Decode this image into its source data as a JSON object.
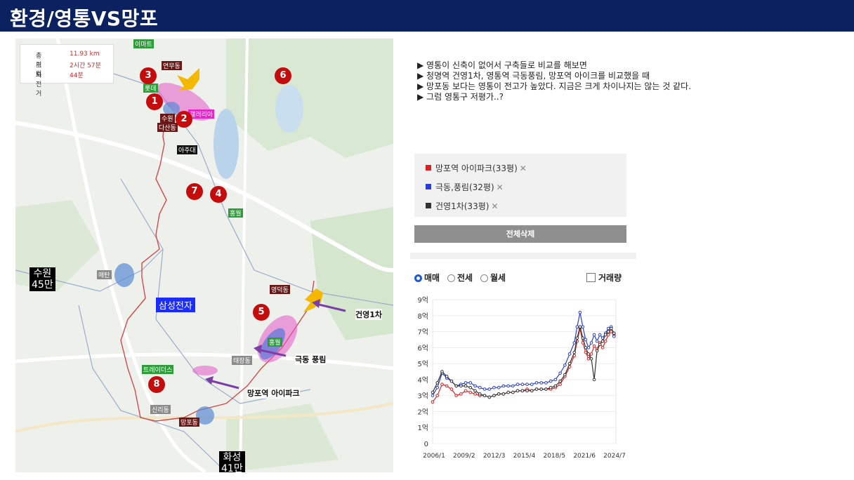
{
  "header": {
    "title": "환경/영통VS망포"
  },
  "map": {
    "route_info": [
      {
        "label": "총거리",
        "value": "11.93 km"
      },
      {
        "label": "도보",
        "value": "2시간 57분"
      },
      {
        "label": "자전거",
        "value": "44분"
      }
    ],
    "place_labels": {
      "emart": "이마트",
      "lotte": "롯데",
      "yeonmu": "연무동",
      "suwon": "수원",
      "dasandong": "다산동",
      "galleria": "갤러리아",
      "ajou": "아주대",
      "hongjin": "홍월",
      "hwangbong": "매탄",
      "samsung": "삼성전자",
      "yeongdeok": "영덕동",
      "yeongtong_green": "홍월",
      "taejang": "태장동",
      "traders": "트레이더스",
      "mangpo": "망포동",
      "sinsu": "신리동"
    },
    "cities": [
      {
        "line1": "수원",
        "line2": "45만"
      },
      {
        "line1": "화성",
        "line2": "41만"
      }
    ],
    "markers": [
      "1",
      "2",
      "3",
      "4",
      "5",
      "6",
      "7",
      "8"
    ],
    "callouts": {
      "gunyoung": "건영1차",
      "geukdong": "극동 풍림",
      "mangpo_ipark": "망포역 아이파크"
    }
  },
  "notes": [
    "▶  영통이 신축이 없어서 구축들로 비교를 해보면",
    "▶  청명역 건영1차, 영통역 극동풍림, 망포역 아이크를 비교했을 때",
    "▶  망포동 보다는 영통이 전고가 높았다.  지금은 크게 차이나지는 않는 것 같다.",
    "▶  그럼 영통구 저평가..?"
  ],
  "legend": [
    {
      "name": "망포역 아이파크(33평)",
      "color": "#e02020",
      "remove": "✕"
    },
    {
      "name": "극동,풍림(32평)",
      "color": "#2b3fd8",
      "remove": "✕"
    },
    {
      "name": "건영1차(33평)",
      "color": "#333333",
      "remove": "✕"
    }
  ],
  "clear_all": "전체삭제",
  "trade_type": {
    "options": [
      "매매",
      "전세",
      "월세"
    ],
    "selected": "매매"
  },
  "volume_label": "거래량",
  "colors": {
    "header": "#0b2160",
    "accent_blue": "#1e5ad8"
  },
  "chart_data": {
    "type": "line",
    "yticks": [
      "9억",
      "8억",
      "7억",
      "6억",
      "5억",
      "4억",
      "3억",
      "2억",
      "1억",
      "0"
    ],
    "xticks": [
      "2006/1",
      "2009/2",
      "2012/3",
      "2015/4",
      "2018/5",
      "2021/6",
      "2024/7"
    ],
    "ylim": [
      0,
      9
    ],
    "xlim": [
      2006.0,
      2025.4
    ],
    "grid": true,
    "series": [
      {
        "name": "망포역 아이파크(33평)",
        "color": "#e02020",
        "x": [
          2006.0,
          2006.5,
          2007.0,
          2007.5,
          2008.0,
          2008.5,
          2009.0,
          2009.5,
          2010.0,
          2010.5,
          2011.0,
          2011.5,
          2012.0,
          2012.5,
          2013.0,
          2013.5,
          2014.0,
          2014.5,
          2015.0,
          2015.5,
          2016.0,
          2016.5,
          2017.0,
          2017.5,
          2018.0,
          2018.5,
          2019.0,
          2019.5,
          2020.0,
          2020.5,
          2021.0,
          2021.3,
          2021.6,
          2021.9,
          2022.2,
          2022.5,
          2022.8,
          2023.1,
          2023.4,
          2023.7,
          2024.0,
          2024.3,
          2024.6,
          2024.9,
          2025.2
        ],
        "values": [
          2.6,
          3.0,
          3.7,
          3.6,
          3.4,
          3.0,
          3.1,
          3.3,
          3.2,
          3.1,
          3.0,
          3.0,
          2.9,
          3.0,
          3.1,
          3.1,
          3.2,
          3.2,
          3.3,
          3.3,
          3.4,
          3.3,
          3.4,
          3.4,
          3.4,
          3.4,
          3.5,
          3.7,
          4.2,
          4.8,
          5.5,
          6.4,
          7.2,
          6.3,
          5.7,
          5.3,
          5.6,
          6.1,
          5.9,
          6.3,
          6.0,
          6.4,
          6.8,
          7.0,
          6.8
        ]
      },
      {
        "name": "극동,풍림(32평)",
        "color": "#2b3fd8",
        "x": [
          2006.0,
          2006.5,
          2007.0,
          2007.5,
          2008.0,
          2008.5,
          2009.0,
          2009.5,
          2010.0,
          2010.5,
          2011.0,
          2011.5,
          2012.0,
          2012.5,
          2013.0,
          2013.5,
          2014.0,
          2014.5,
          2015.0,
          2015.5,
          2016.0,
          2016.5,
          2017.0,
          2017.5,
          2018.0,
          2018.5,
          2019.0,
          2019.5,
          2020.0,
          2020.5,
          2021.0,
          2021.3,
          2021.6,
          2021.9,
          2022.2,
          2022.5,
          2022.8,
          2023.1,
          2023.4,
          2023.7,
          2024.0,
          2024.3,
          2024.6,
          2024.9,
          2025.2
        ],
        "values": [
          3.0,
          3.5,
          4.4,
          4.1,
          3.9,
          3.6,
          3.7,
          3.8,
          3.8,
          3.6,
          3.5,
          3.4,
          3.4,
          3.5,
          3.5,
          3.6,
          3.6,
          3.6,
          3.7,
          3.7,
          3.7,
          3.7,
          3.8,
          3.8,
          3.8,
          3.9,
          4.0,
          4.4,
          4.9,
          5.6,
          6.3,
          7.3,
          8.2,
          7.3,
          6.5,
          6.0,
          6.3,
          6.8,
          6.4,
          6.8,
          6.6,
          6.9,
          7.2,
          7.3,
          6.7
        ]
      },
      {
        "name": "건영1차(33평)",
        "color": "#333333",
        "x": [
          2006.0,
          2006.5,
          2007.0,
          2007.5,
          2008.0,
          2008.5,
          2009.0,
          2009.5,
          2010.0,
          2010.5,
          2011.0,
          2011.5,
          2012.0,
          2012.5,
          2013.0,
          2013.5,
          2014.0,
          2014.5,
          2015.0,
          2015.5,
          2016.0,
          2016.5,
          2017.0,
          2017.5,
          2018.0,
          2018.5,
          2019.0,
          2019.5,
          2020.0,
          2020.5,
          2021.0,
          2021.3,
          2021.6,
          2021.9,
          2022.2,
          2022.5,
          2022.8,
          2023.1,
          2023.4,
          2023.7,
          2024.0,
          2024.3,
          2024.6,
          2024.9,
          2025.2
        ],
        "values": [
          3.2,
          3.8,
          4.5,
          4.2,
          3.9,
          3.6,
          3.6,
          3.6,
          3.5,
          3.3,
          3.1,
          3.0,
          2.9,
          3.0,
          3.1,
          3.1,
          3.2,
          3.2,
          3.3,
          3.3,
          3.3,
          3.3,
          3.4,
          3.4,
          3.4,
          3.5,
          3.6,
          3.9,
          4.3,
          5.0,
          5.7,
          6.6,
          7.3,
          6.6,
          6.0,
          5.6,
          5.3,
          4.0,
          5.8,
          6.2,
          6.4,
          6.8,
          7.0,
          7.2,
          6.9
        ]
      }
    ]
  }
}
